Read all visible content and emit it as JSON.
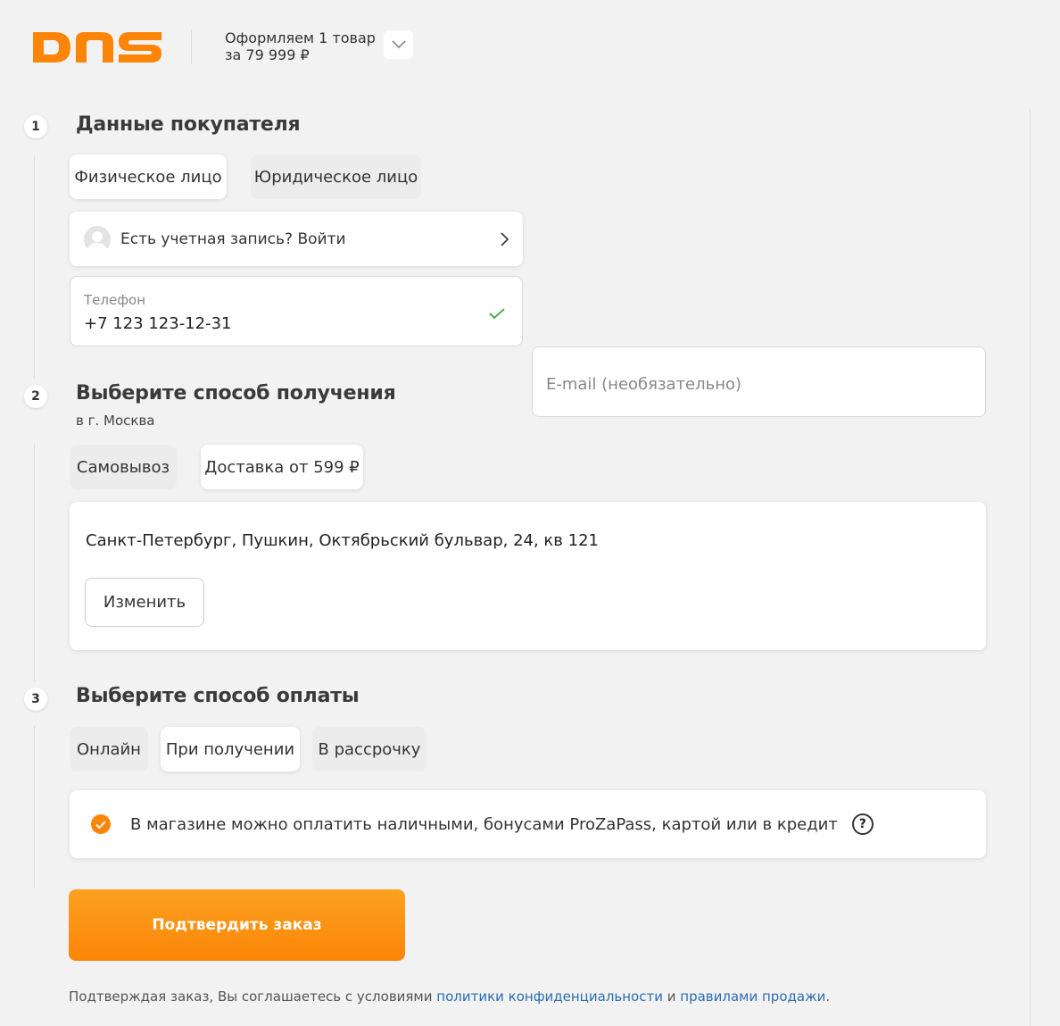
{
  "header": {
    "logo_text": "DNS",
    "summary_line1": "Оформляем 1 товар",
    "summary_line2": "за 79 999 ₽"
  },
  "step1": {
    "number": "1",
    "title": "Данные покупателя",
    "buyer_types": [
      "Физическое лицо",
      "Юридическое лицо"
    ],
    "login_label": "Есть учетная запись? Войти",
    "phone_caption": "Телефон",
    "phone_value": "+7 123 123-12-31",
    "email_placeholder": "E-mail (необязательно)"
  },
  "step2": {
    "number": "2",
    "title": "Выберите способ получения",
    "city": "в г. Москва",
    "methods": [
      "Самовывоз",
      "Доставка от 599 ₽"
    ],
    "address": "Санкт-Петербург, Пушкин, Октябрьский бульвар, 24, кв 121",
    "change_label": "Изменить"
  },
  "step3": {
    "number": "3",
    "title": "Выберите способ оплаты",
    "methods": [
      "Онлайн",
      "При получении",
      "В рассрочку"
    ],
    "payment_info": "В магазине можно оплатить наличными, бонусами ProZaPass, картой или в кредит",
    "help_symbol": "?"
  },
  "confirm_label": "Подтвердить заказ",
  "terms": {
    "prefix": "Подтверждая заказ, Вы соглашаетесь с условиями ",
    "privacy_link": "политики конфиденциальности",
    "middle": " и ",
    "rules_link": "правилами продажи",
    "suffix": "."
  },
  "colors": {
    "brand_orange": "#fc8507",
    "link_blue": "#2b6db0",
    "success_green": "#4caf50"
  },
  "icons": {
    "logo": "dns-logo-icon",
    "toggle": "chevron-down-icon",
    "login_avatar": "user-avatar-icon",
    "login_arrow": "chevron-right-icon",
    "phone_valid": "checkmark-icon",
    "payment_selected": "check-circle-icon",
    "help": "question-circle-icon"
  }
}
